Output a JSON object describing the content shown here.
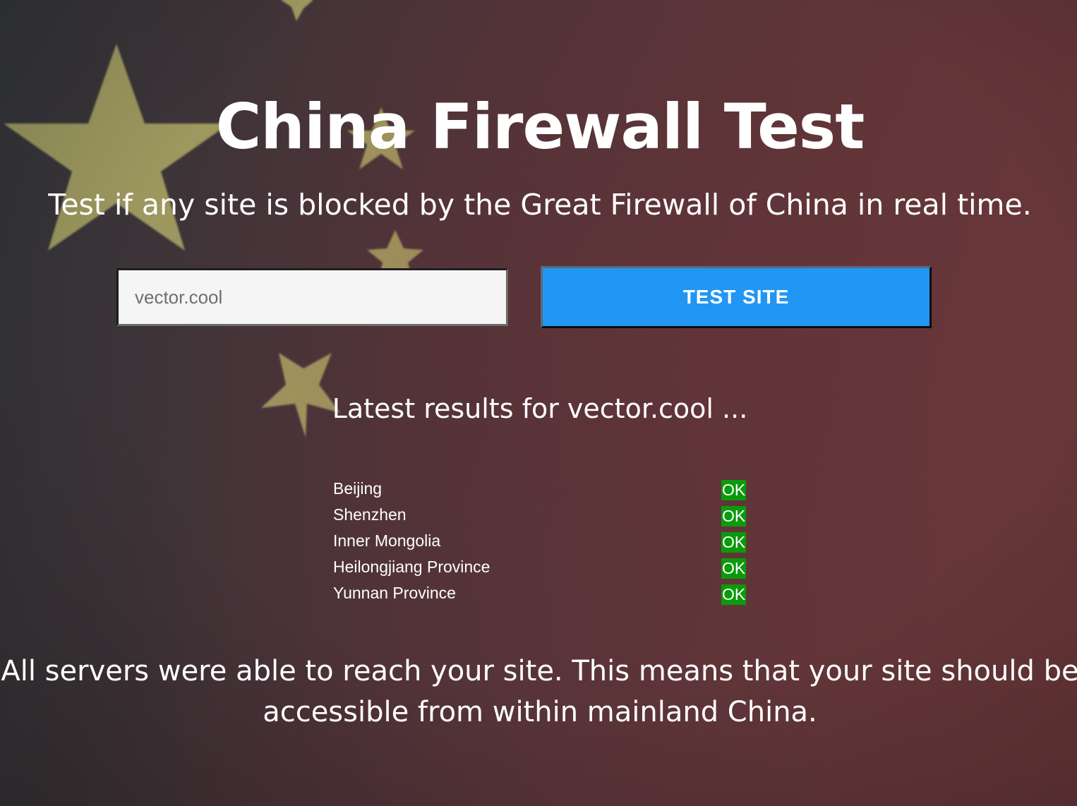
{
  "page": {
    "title": "China Firewall Test",
    "subtitle": "Test if any site is blocked by the Great Firewall of China in real time."
  },
  "form": {
    "input_value": "vector.cool",
    "button_label": "TEST SITE"
  },
  "results": {
    "heading": "Latest results for vector.cool ...",
    "rows": [
      {
        "location": "Beijing",
        "status": "OK"
      },
      {
        "location": "Shenzhen",
        "status": "OK"
      },
      {
        "location": "Inner Mongolia",
        "status": "OK"
      },
      {
        "location": "Heilongjiang Province",
        "status": "OK"
      },
      {
        "location": "Yunnan Province",
        "status": "OK"
      }
    ]
  },
  "conclusion": {
    "line1": "All servers were able to reach your site. This means that your site should be",
    "line2": "accessible from within mainland China."
  },
  "colors": {
    "accent": "#2196f3",
    "status_ok": "#0b9a0b",
    "star": "#b9b46a",
    "background": "#5b3438"
  }
}
